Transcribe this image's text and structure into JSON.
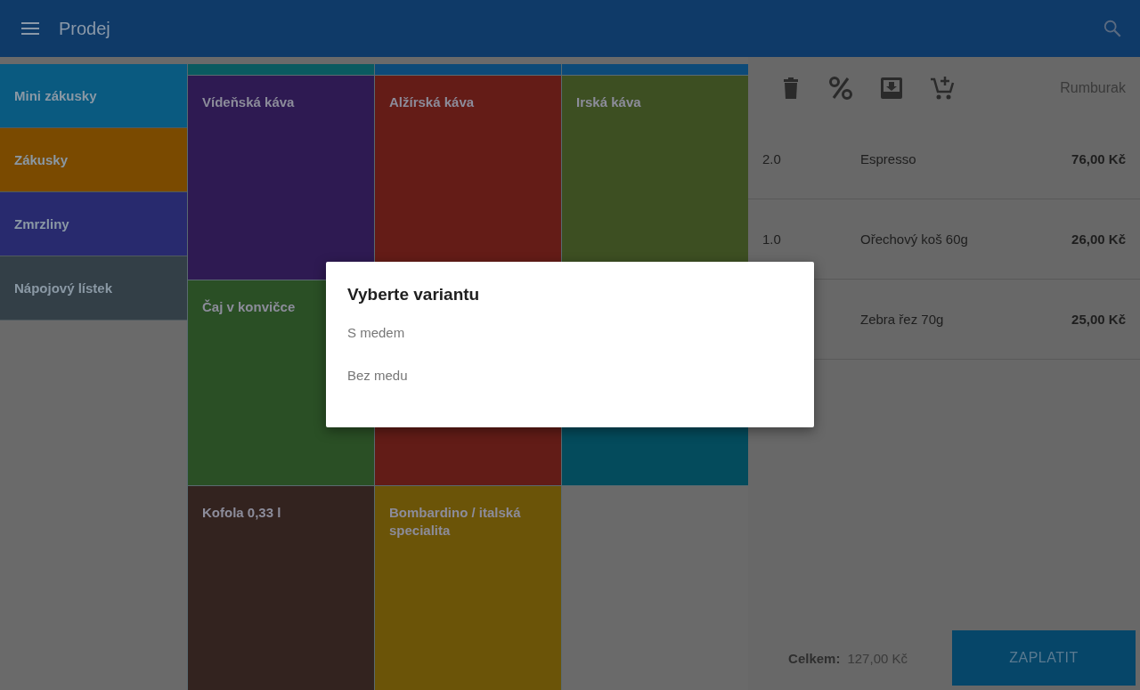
{
  "app_bar": {
    "title": "Prodej"
  },
  "categories": [
    {
      "label": "Mini zákusky",
      "color": "#0a5a80"
    },
    {
      "label": "Zákusky",
      "color": "#7a4a00"
    },
    {
      "label": "Zmrzliny",
      "color": "#282a6e"
    },
    {
      "label": "Nápojový lístek",
      "color": "#333f47"
    }
  ],
  "products_top_strip": [
    {
      "color": "#0a5a60"
    },
    {
      "color": "#0d4a78"
    },
    {
      "color": "#0d4a78"
    }
  ],
  "products": [
    {
      "label": "Vídeňská káva",
      "color": "#2e1a52"
    },
    {
      "label": "Alžírská káva",
      "color": "#641c17"
    },
    {
      "label": "Irská káva",
      "color": "#3d4f22"
    },
    {
      "label": "Čaj v konvičce",
      "color": "#2a4f25"
    },
    {
      "color": "#621c17"
    },
    {
      "color": "#044b5c"
    },
    {
      "label": "Kofola 0,33 l",
      "color": "#33231f"
    },
    {
      "label": "Bombardino / italská specialita",
      "color": "#6b5408"
    }
  ],
  "order": {
    "customer": "Rumburak",
    "items": [
      {
        "quantity": "2.0",
        "name": "Espresso",
        "price": "76,00 Kč"
      },
      {
        "quantity": "1.0",
        "name": "Ořechový koš 60g",
        "price": "26,00 Kč"
      },
      {
        "name": "Zebra řez 70g",
        "price": "25,00 Kč"
      }
    ],
    "total_label": "Celkem:",
    "total": "127,00 Kč",
    "pay_button": "ZAPLATIT"
  },
  "dialog": {
    "title": "Vyberte variantu",
    "options": [
      "S medem",
      "Bez medu"
    ]
  }
}
